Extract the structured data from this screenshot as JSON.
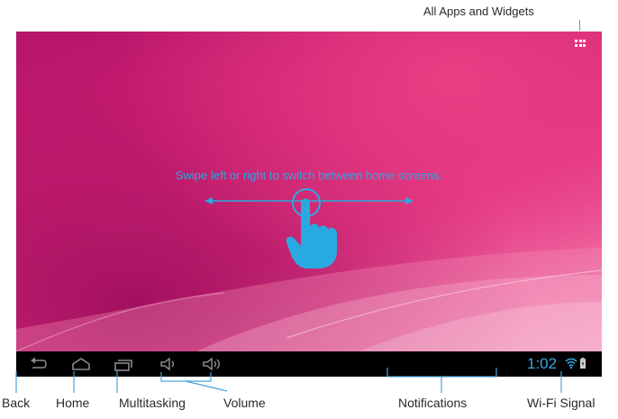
{
  "callouts": {
    "all_apps": "All Apps and Widgets",
    "back": "Back",
    "home": "Home",
    "multitasking": "Multitasking",
    "volume": "Volume",
    "notifications": "Notifications",
    "wifi": "Wi-Fi Signal"
  },
  "home_screen": {
    "hint": "Swipe left or right to switch between home screens.",
    "wallpaper_colors": [
      "#b51569",
      "#e33583",
      "#f59cbd"
    ],
    "hint_color": "#29a9e1"
  },
  "status_bar": {
    "time": "1:02",
    "accent_color": "#36a8e0",
    "icons": [
      "wifi-icon",
      "battery-icon"
    ]
  },
  "nav_bar": {
    "buttons": [
      "back-icon",
      "home-icon",
      "recent-apps-icon",
      "volume-down-icon",
      "volume-up-icon"
    ]
  }
}
